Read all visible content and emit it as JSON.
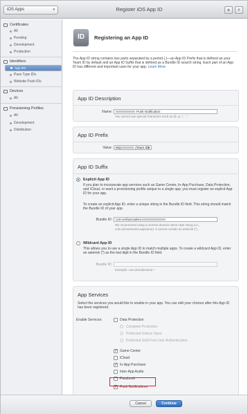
{
  "topbar": {
    "platform": "iOS Apps",
    "title": "Register iOS App ID",
    "add": "+",
    "search": "⌕"
  },
  "sidebar": {
    "sections": [
      {
        "title": "Certificates",
        "items": [
          "All",
          "Pending",
          "Development",
          "Production"
        ]
      },
      {
        "title": "Identifiers",
        "items": [
          "App IDs",
          "Pass Type IDs",
          "Website Push IDs"
        ]
      },
      {
        "title": "Devices",
        "items": [
          "All"
        ]
      },
      {
        "title": "Provisioning Profiles",
        "items": [
          "All",
          "Development",
          "Distribution"
        ]
      }
    ],
    "selected": "App IDs"
  },
  "main": {
    "icon_text": "ID",
    "heading": "Registering an App ID",
    "intro": "The App ID string contains two parts separated by a period (.)—an App ID Prefix that is defined as your Team ID by default and an App ID Suffix that is defined as a Bundle ID search string. Each part of an App ID has different and important uses for your app.",
    "learn_more": "Learn More",
    "description": {
      "title": "App ID Description",
      "name_label": "Name:",
      "name_value": "Push Notification",
      "name_hint": "You cannot use special characters such as @, &, *, ', \""
    },
    "prefix": {
      "title": "App ID Prefix",
      "value_label": "Value:",
      "value": "(Team ID)",
      "value_prefix": "MQ"
    },
    "suffix": {
      "title": "App ID Suffix",
      "explicit_title": "Explicit App ID",
      "explicit_text1": "If you plan to incorporate app services such as Game Center, In-App Purchase, Data Protection, and iCloud, or want a provisioning profile unique to a single app, you must register an explicit App ID for your app.",
      "explicit_text2": "To create an explicit App ID, enter a unique string in the Bundle ID field. This string should match the Bundle ID of your app.",
      "bundle_label": "Bundle ID:",
      "bundle_value": "com.embarcadero.",
      "bundle_hint": "We recommend using a reverse-domain name style string (i.e., com.domainname.appname). It cannot contain an asterisk (*).",
      "wildcard_title": "Wildcard App ID",
      "wildcard_text": "This allows you to use a single App ID to match multiple apps. To create a wildcard App ID, enter an asterisk (*) as the last digit in the Bundle ID field.",
      "wildcard_bundle_label": "Bundle ID:",
      "wildcard_hint": "Example: com.domainname.*"
    },
    "services": {
      "title": "App Services",
      "desc": "Select the services you would like to enable in your app. You can edit your choices after this App ID has been registered.",
      "enable_label": "Enable Services:",
      "data_protection": "Data Protection",
      "dp_options": [
        "Complete Protection",
        "Protected Unless Open",
        "Protected Until First User Authentication"
      ],
      "items": [
        {
          "label": "Game Center",
          "checked": true
        },
        {
          "label": "iCloud",
          "checked": false
        },
        {
          "label": "In-App Purchase",
          "checked": true
        },
        {
          "label": "Inter-App Audio",
          "checked": false
        },
        {
          "label": "Passbook",
          "checked": false
        },
        {
          "label": "Push Notifications",
          "checked": true
        }
      ]
    }
  },
  "footer": {
    "cancel": "Cancel",
    "continue": "Continue"
  },
  "colors": {
    "accent": "#2f6cc0",
    "highlight": "#d92020",
    "sidebar_bg": "#eef0f3"
  }
}
